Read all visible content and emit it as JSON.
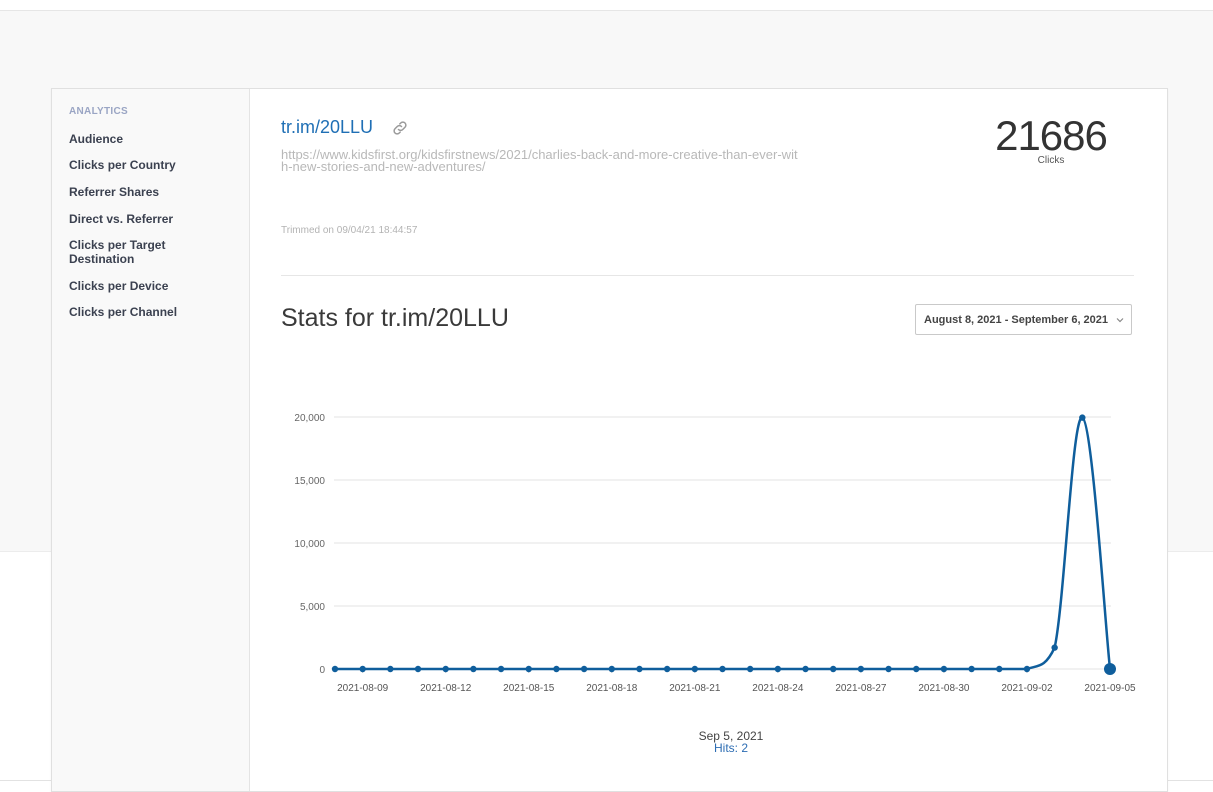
{
  "sidebar": {
    "heading": "ANALYTICS",
    "items": [
      {
        "label": "Audience"
      },
      {
        "label": "Clicks per Country"
      },
      {
        "label": "Referrer Shares"
      },
      {
        "label": "Direct vs. Referrer"
      },
      {
        "label": "Clicks per Target Destination"
      },
      {
        "label": "Clicks per Device"
      },
      {
        "label": "Clicks per Channel"
      }
    ]
  },
  "link": {
    "short_url": "tr.im/20LLU",
    "link_icon": "link-icon",
    "long_url": "https://www.kidsfirst.org/kidsfirstnews/2021/charlies-back-and-more-creative-than-ever-with-new-stories-and-new-adventures/",
    "trimmed_on": "Trimmed on 09/04/21 18:44:57"
  },
  "clicks": {
    "count": "21686",
    "label": "Clicks"
  },
  "stats": {
    "title": "Stats for tr.im/20LLU",
    "date_range": "August 8, 2021 - September 6, 2021",
    "dropdown_icon": "chevron-down-icon"
  },
  "tooltip": {
    "date": "Sep 5, 2021",
    "hits": "Hits: 2"
  },
  "colors": {
    "link": "#1f6fb5",
    "series": "#0f5e9c"
  },
  "chart_data": {
    "type": "line",
    "x_tick_labels": [
      "2021-08-09",
      "2021-08-12",
      "2021-08-15",
      "2021-08-18",
      "2021-08-21",
      "2021-08-24",
      "2021-08-27",
      "2021-08-30",
      "2021-09-02",
      "2021-09-05"
    ],
    "y_tick_labels": [
      "20,000",
      "15,000",
      "10,000",
      "5,000",
      "0"
    ],
    "y_ticks": [
      20000,
      15000,
      10000,
      5000,
      0
    ],
    "ylim": [
      0,
      20000
    ],
    "x": [
      "2021-08-08",
      "2021-08-09",
      "2021-08-10",
      "2021-08-11",
      "2021-08-12",
      "2021-08-13",
      "2021-08-14",
      "2021-08-15",
      "2021-08-16",
      "2021-08-17",
      "2021-08-18",
      "2021-08-19",
      "2021-08-20",
      "2021-08-21",
      "2021-08-22",
      "2021-08-23",
      "2021-08-24",
      "2021-08-25",
      "2021-08-26",
      "2021-08-27",
      "2021-08-28",
      "2021-08-29",
      "2021-08-30",
      "2021-08-31",
      "2021-09-01",
      "2021-09-02",
      "2021-09-03",
      "2021-09-04",
      "2021-09-05"
    ],
    "values": [
      0,
      0,
      0,
      0,
      0,
      0,
      0,
      0,
      0,
      0,
      0,
      0,
      0,
      0,
      0,
      0,
      0,
      0,
      0,
      0,
      0,
      0,
      0,
      0,
      0,
      0,
      1700,
      19950,
      2
    ],
    "highlight_date": "2021-09-05",
    "grid": true
  }
}
